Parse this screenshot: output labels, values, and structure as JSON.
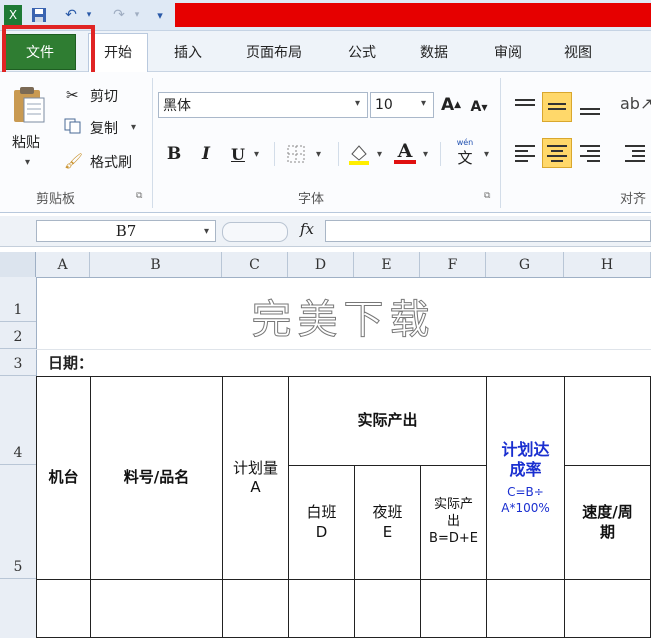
{
  "quick_access": {
    "excel_icon": "excel-icon",
    "save_icon": "save-icon",
    "undo_icon": "undo-icon",
    "redo_icon": "redo-icon"
  },
  "tabs": [
    {
      "label": "文件"
    },
    {
      "label": "开始"
    },
    {
      "label": "插入"
    },
    {
      "label": "页面布局"
    },
    {
      "label": "公式"
    },
    {
      "label": "数据"
    },
    {
      "label": "审阅"
    },
    {
      "label": "视图"
    }
  ],
  "clipboard": {
    "paste": "粘贴",
    "cut": "剪切",
    "copy": "复制",
    "format_painter": "格式刷",
    "group": "剪贴板"
  },
  "font": {
    "name": "黑体",
    "size": "10",
    "group": "字体",
    "bold": "B",
    "italic": "I",
    "underline": "U",
    "font_color": "A",
    "phonetic": "wén"
  },
  "alignment": {
    "group": "对齐"
  },
  "formula_bar": {
    "name_box": "B7",
    "fx": "fx"
  },
  "columns": [
    "A",
    "B",
    "C",
    "D",
    "E",
    "F",
    "G",
    "H"
  ],
  "rows": [
    "1",
    "2",
    "3",
    "4",
    "5"
  ],
  "sheet": {
    "title": "完美下载",
    "date_label": "日期：",
    "machine": "机台",
    "part": "料号/品名",
    "plan_qty": "计划量\nA",
    "actual_output": "实际产出",
    "day_shift": "白班\nD",
    "night_shift": "夜班\nE",
    "actual_total": "实际产\n出\nB=D+E",
    "plan_rate": "计划达\n成率",
    "plan_rate_formula": "C=B÷\nA*100%",
    "speed": "速度/周\n期"
  },
  "colors": {
    "file_tab": "#2f7d32",
    "highlight": "#e02424",
    "redbar": "#e60000",
    "blue_text": "#1a2fd0",
    "selected": "#ffd86a"
  }
}
